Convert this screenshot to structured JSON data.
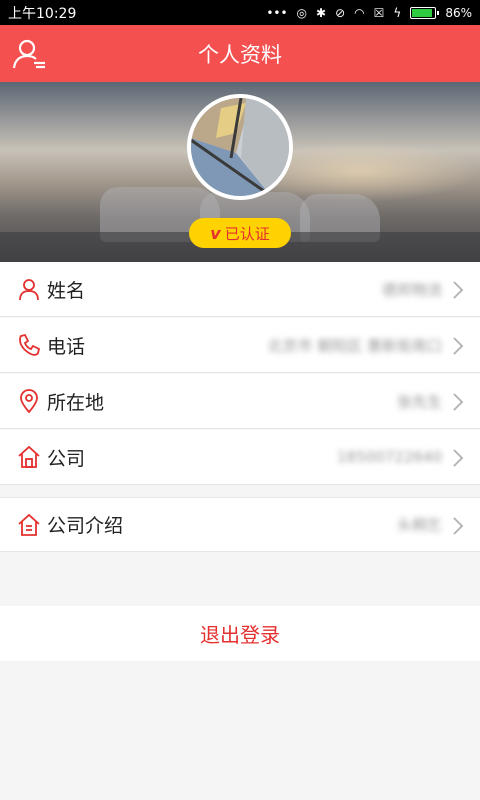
{
  "status_bar": {
    "time": "上午10:29",
    "battery": "86%",
    "battery_level": 0.86
  },
  "header": {
    "title": "个人资料"
  },
  "profile": {
    "verified_mark": "v",
    "verified_label": "已认证"
  },
  "fields": [
    {
      "label": "姓名",
      "value": "德邦物流",
      "icon": "user-icon"
    },
    {
      "label": "电话",
      "value": "北京市 朝阳区 惠新街南口",
      "icon": "phone-icon"
    },
    {
      "label": "所在地",
      "value": "张先生",
      "icon": "location-pin-icon"
    },
    {
      "label": "公司",
      "value": "18500722640",
      "icon": "home-icon"
    },
    {
      "label": "公司介绍",
      "value": "头桐乞",
      "icon": "company-info-icon"
    }
  ],
  "actions": {
    "logout_label": "退出登录"
  },
  "colors": {
    "primary": "#f4504f",
    "accent_text": "#e4302f",
    "badge": "#ffd200"
  }
}
